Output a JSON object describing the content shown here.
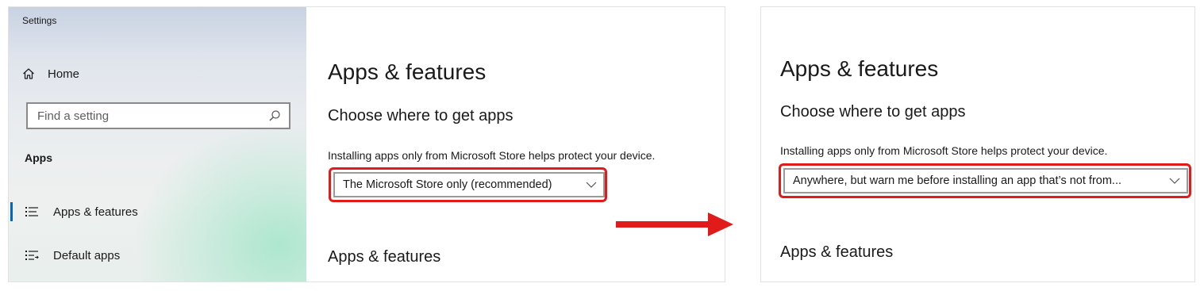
{
  "left_window": {
    "title": "Settings",
    "home_label": "Home",
    "search": {
      "placeholder": "Find a setting",
      "value": ""
    },
    "section_label": "Apps",
    "nav": [
      {
        "label": "Apps & features",
        "icon": "apps-list-icon",
        "active": true
      },
      {
        "label": "Default apps",
        "icon": "default-apps-icon",
        "active": false
      }
    ],
    "page_title": "Apps & features",
    "subheading": "Choose where to get apps",
    "description": "Installing apps only from Microsoft Store helps protect your device.",
    "dropdown_value": "The Microsoft Store only (recommended)",
    "lower_heading": "Apps & features"
  },
  "right_window": {
    "page_title": "Apps & features",
    "subheading": "Choose where to get apps",
    "description": "Installing apps only from Microsoft Store helps protect your device.",
    "dropdown_value": "Anywhere, but warn me before installing an app that’s not from...",
    "lower_heading": "Apps & features"
  },
  "colors": {
    "highlight": "#e11a1a",
    "arrow": "#e11a1a",
    "accent": "#0067c0"
  }
}
